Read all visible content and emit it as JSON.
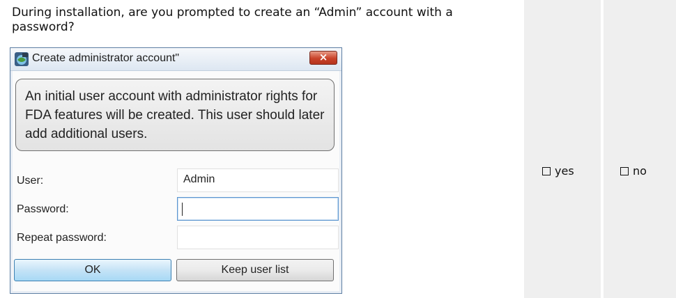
{
  "question": {
    "text": "During installation, are you prompted to create an “Admin” account with a password?"
  },
  "choices": {
    "yes": "yes",
    "no": "no"
  },
  "dialog": {
    "title": "Create administrator account\"",
    "close_label": "×",
    "info_text": "An initial user account with administrator rights for FDA features will be created. This user should later add additional users.",
    "fields": {
      "user": {
        "label": "User:",
        "value": "Admin"
      },
      "password": {
        "label": "Password:",
        "value": ""
      },
      "repeat_password": {
        "label": "Repeat password:",
        "value": ""
      }
    },
    "buttons": {
      "ok": "OK",
      "keep_user_list": "Keep user list"
    }
  },
  "colors": {
    "answer_column_bg": "#efefef",
    "close_button": "#c9432a",
    "ok_button": "#c5e3f6"
  },
  "icons": {
    "app": "app-globe-icon",
    "checkbox": "checkbox-empty-icon",
    "close": "close-icon"
  }
}
